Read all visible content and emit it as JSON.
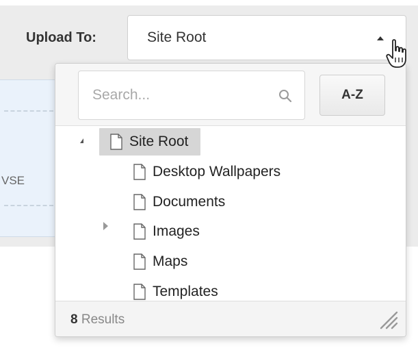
{
  "upload": {
    "label": "Upload To:",
    "selected_value": "Site Root"
  },
  "dropzone": {
    "partial_text": "VSE"
  },
  "dropdown": {
    "search_placeholder": "Search...",
    "sort_button_label": "A-Z",
    "tree": [
      {
        "label": "Site Root",
        "level": 0,
        "expanded": true,
        "selected": true
      },
      {
        "label": "Desktop Wallpapers",
        "level": 1,
        "expanded": false,
        "selected": false
      },
      {
        "label": "Documents",
        "level": 1,
        "expanded": false,
        "selected": false
      },
      {
        "label": "Images",
        "level": 1,
        "expanded": false,
        "selected": false,
        "has_children": true
      },
      {
        "label": "Maps",
        "level": 1,
        "expanded": false,
        "selected": false
      },
      {
        "label": "Templates",
        "level": 1,
        "expanded": false,
        "selected": false
      }
    ],
    "footer": {
      "results_count": "8",
      "results_label": " Results"
    }
  },
  "icons": {
    "document": "document-icon",
    "search": "search-icon",
    "resize": "resize-handle-icon",
    "cursor": "hand-pointer-cursor-icon",
    "caret": "caret-up-icon"
  }
}
